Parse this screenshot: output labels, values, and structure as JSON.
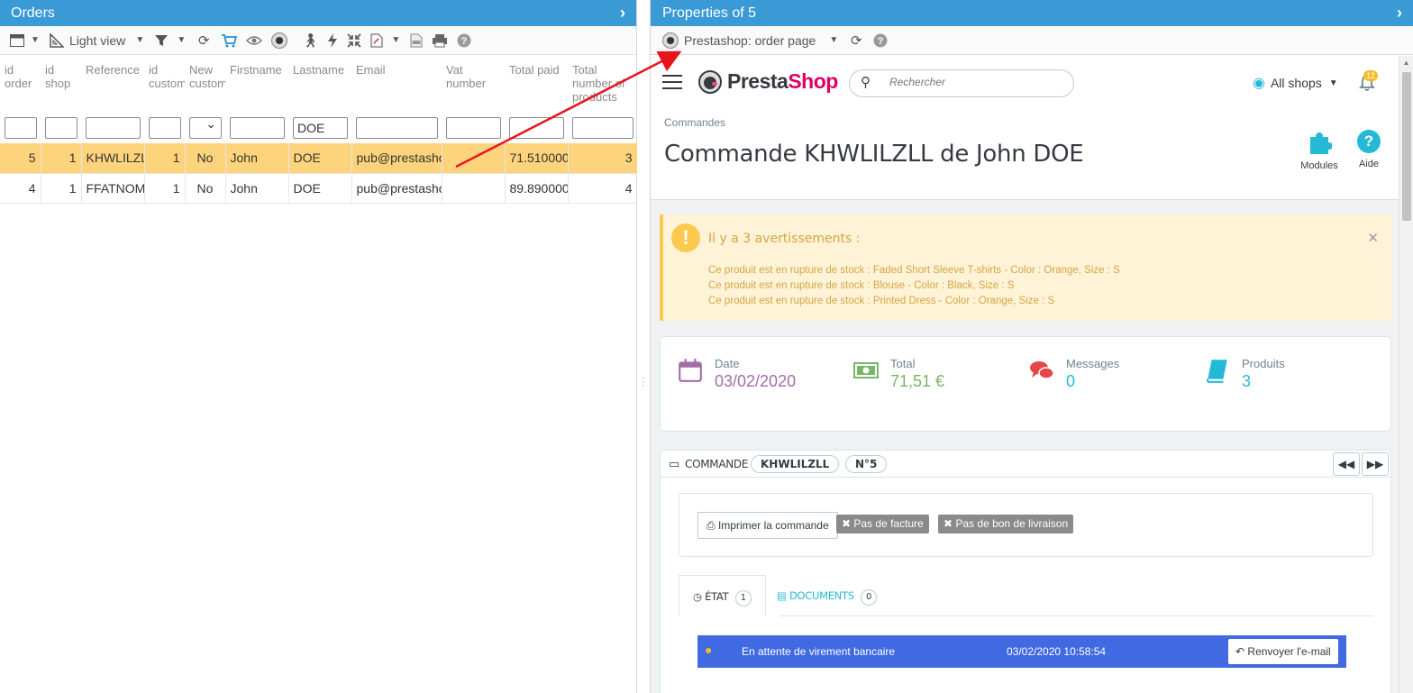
{
  "left_panel": {
    "title": "Orders",
    "toolbar": {
      "light_view_label": "Light view"
    },
    "columns": [
      "id order",
      "id shop",
      "Reference",
      "id customer",
      "New customer",
      "Firstname",
      "Lastname",
      "Email",
      "Vat number",
      "Total paid",
      "Total number of products"
    ],
    "filters": {
      "lastname": "DOE"
    },
    "rows": [
      {
        "id_order": "5",
        "id_shop": "1",
        "reference": "KHWLILZLL",
        "id_customer": "1",
        "new_customer": "No",
        "firstname": "John",
        "lastname": "DOE",
        "email": "pub@prestashop.com",
        "vat": "",
        "total_paid": "71.510000",
        "total_products": "3"
      },
      {
        "id_order": "4",
        "id_shop": "1",
        "reference": "FFATNOMMJ",
        "id_customer": "1",
        "new_customer": "No",
        "firstname": "John",
        "lastname": "DOE",
        "email": "pub@prestashop.com",
        "vat": "",
        "total_paid": "89.890000",
        "total_products": "4"
      }
    ]
  },
  "right_panel": {
    "title": "Properties of 5",
    "view_select": "Prestashop: order page",
    "brand_a": "Presta",
    "brand_b": "Shop",
    "search_placeholder": "Rechercher",
    "shops_label": "All shops",
    "notif_count": "12",
    "breadcrumb": "Commandes",
    "page_title": "Commande KHWLILZLL de John DOE",
    "modules_label": "Modules",
    "help_label": "Aide",
    "alert": {
      "title": "Il y a 3 avertissements :",
      "items": [
        "Ce produit est en rupture de stock : Faded Short Sleeve T-shirts - Color : Orange, Size : S",
        "Ce produit est en rupture de stock : Blouse - Color : Black, Size : S",
        "Ce produit est en rupture de stock : Printed Dress - Color : Orange, Size : S"
      ]
    },
    "kpis": {
      "date_label": "Date",
      "date_value": "03/02/2020",
      "total_label": "Total",
      "total_value": "71,51 €",
      "messages_label": "Messages",
      "messages_value": "0",
      "products_label": "Produits",
      "products_value": "3"
    },
    "order": {
      "label": "COMMANDE",
      "reference": "KHWLILZLL",
      "number": "N°5",
      "print_label": "Imprimer la commande",
      "no_invoice": "Pas de facture",
      "no_delivery": "Pas de bon de livraison",
      "tab_state": "ÉTAT",
      "tab_state_count": "1",
      "tab_docs": "DOCUMENTS",
      "tab_docs_count": "0",
      "status_text": "En attente de virement bancaire",
      "status_date": "03/02/2020 10:58:54",
      "resend_label": "Renvoyer l'e-mail"
    }
  },
  "colors": {
    "header_blue": "#3a9ad6",
    "row_selected": "#fdd47b",
    "prestashop_pink": "#df0067",
    "accent_cyan": "#25b9d7",
    "status_blue": "#4169e1",
    "warning_bg": "#fff3d7",
    "arrow_red": "#e8141c"
  }
}
